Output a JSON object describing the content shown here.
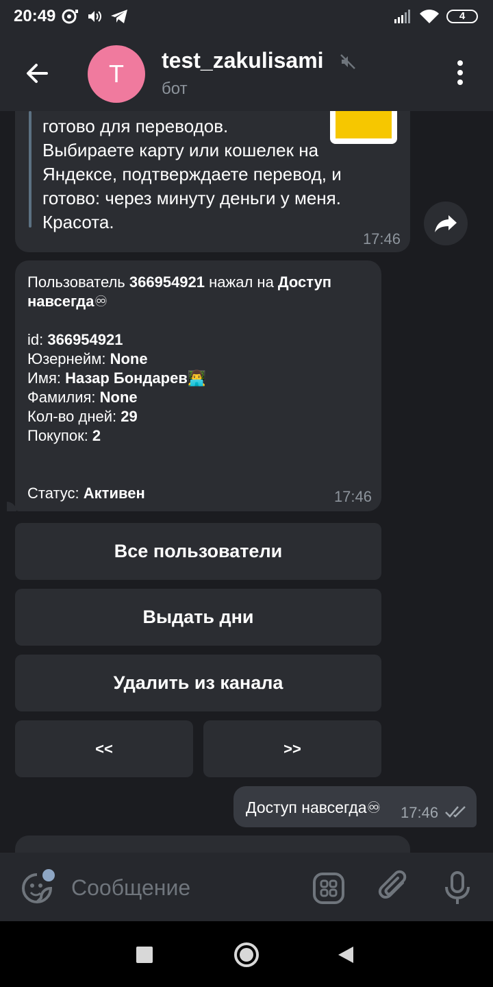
{
  "status_bar": {
    "time": "20:49",
    "battery": "4"
  },
  "header": {
    "avatar_letter": "T",
    "title": "test_zakulisami",
    "subtitle": "бот"
  },
  "messages": {
    "m1": {
      "lines": [
        "готово для переводов.",
        "Выбираете карту или кошелек на",
        "Яндексе, подтверждаете перевод, и",
        "готово: через минуту деньги у меня.",
        "Красота."
      ],
      "time": "17:46"
    },
    "m2": {
      "line1_prefix": "Пользователь ",
      "user_id": "366954921",
      "line1_middle": " нажал на ",
      "access_line1": "Доступ",
      "access_line2": "навсегда♾",
      "id_label": "id: ",
      "id_value": "366954921",
      "username_label": "Юзернейм: ",
      "username_value": "None",
      "name_label": "Имя: ",
      "name_value": "Назар Бондарев👨‍💻",
      "surname_label": "Фамилия: ",
      "surname_value": "None",
      "days_label": "Кол-во дней: ",
      "days_value": "29",
      "purchases_label": "Покупок: ",
      "purchases_value": "2",
      "status_label": "Статус: ",
      "status_value": "Активен",
      "time": "17:46"
    },
    "keyboard": {
      "all_users": "Все пользователи",
      "give_days": "Выдать дни",
      "remove_from_channel": "Удалить из канала",
      "prev": "<<",
      "next": ">>"
    },
    "m3": {
      "text": "Доступ навсегда♾",
      "time": "17:46"
    }
  },
  "input": {
    "placeholder": "Сообщение"
  },
  "colors": {
    "background": "#1b1c20",
    "header": "#26282d",
    "bubble": "#2b2d32",
    "outgoing_bubble": "#383b42",
    "avatar": "#f07a9e",
    "muted_text": "#8d949c"
  }
}
